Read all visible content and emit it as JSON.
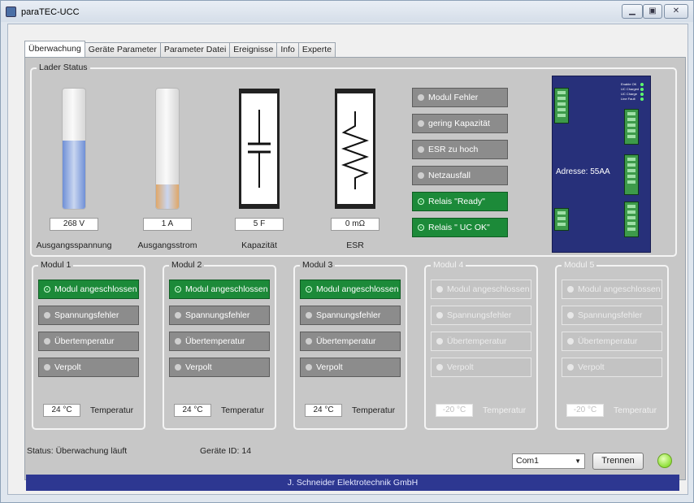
{
  "window": {
    "title": "paraTEC-UCC",
    "icon": "app-icon",
    "controls": [
      "minimize",
      "maximize",
      "close"
    ]
  },
  "tabs": [
    {
      "label": "Überwachung",
      "active": true
    },
    {
      "label": "Geräte Parameter",
      "active": false
    },
    {
      "label": "Parameter Datei",
      "active": false
    },
    {
      "label": "Ereignisse",
      "active": false
    },
    {
      "label": "Info",
      "active": false
    },
    {
      "label": "Experte",
      "active": false
    }
  ],
  "lader": {
    "title": "Lader Status",
    "gauges": [
      {
        "value": "268 V",
        "label": "Ausgangsspannung",
        "level": 0.57,
        "color": "#6f8fd6"
      },
      {
        "value": "1 A",
        "label": "Ausgangsstrom",
        "level": 0.2,
        "color": "#e0a768"
      }
    ],
    "components": [
      {
        "value": "5 F",
        "label": "Kapazität",
        "icon": "capacitor-icon"
      },
      {
        "value": "0 mΩ",
        "label": "ESR",
        "icon": "resistor-icon"
      }
    ],
    "indicators": [
      {
        "label": "Modul Fehler",
        "state": "off"
      },
      {
        "label": "gering Kapazität",
        "state": "off"
      },
      {
        "label": "ESR zu hoch",
        "state": "off"
      },
      {
        "label": "Netzausfall",
        "state": "off"
      },
      {
        "label": "Relais \"Ready\"",
        "state": "on"
      },
      {
        "label": "Relais \" UC OK\"",
        "state": "on"
      }
    ],
    "device": {
      "address": "Adresse: 55AA",
      "leds": [
        "Enable OK",
        "UC Charged",
        "UC Charge",
        "Line Fault"
      ]
    }
  },
  "modules": [
    {
      "title": "Modul 1",
      "enabled": true,
      "indicators": [
        {
          "label": "Modul angeschlossen",
          "state": "on"
        },
        {
          "label": "Spannungsfehler",
          "state": "off"
        },
        {
          "label": "Übertemperatur",
          "state": "off"
        },
        {
          "label": "Verpolt",
          "state": "off"
        }
      ],
      "temperature": "24 °C",
      "temp_label": "Temperatur"
    },
    {
      "title": "Modul 2",
      "enabled": true,
      "indicators": [
        {
          "label": "Modul angeschlossen",
          "state": "on"
        },
        {
          "label": "Spannungsfehler",
          "state": "off"
        },
        {
          "label": "Übertemperatur",
          "state": "off"
        },
        {
          "label": "Verpolt",
          "state": "off"
        }
      ],
      "temperature": "24 °C",
      "temp_label": "Temperatur"
    },
    {
      "title": "Modul 3",
      "enabled": true,
      "indicators": [
        {
          "label": "Modul angeschlossen",
          "state": "on"
        },
        {
          "label": "Spannungsfehler",
          "state": "off"
        },
        {
          "label": "Übertemperatur",
          "state": "off"
        },
        {
          "label": "Verpolt",
          "state": "off"
        }
      ],
      "temperature": "24 °C",
      "temp_label": "Temperatur"
    },
    {
      "title": "Modul 4",
      "enabled": false,
      "indicators": [
        {
          "label": "Modul angeschlossen",
          "state": "off"
        },
        {
          "label": "Spannungsfehler",
          "state": "off"
        },
        {
          "label": "Übertemperatur",
          "state": "off"
        },
        {
          "label": "Verpolt",
          "state": "off"
        }
      ],
      "temperature": "-20 °C",
      "temp_label": "Temperatur"
    },
    {
      "title": "Modul 5",
      "enabled": false,
      "indicators": [
        {
          "label": "Modul angeschlossen",
          "state": "off"
        },
        {
          "label": "Spannungsfehler",
          "state": "off"
        },
        {
          "label": "Übertemperatur",
          "state": "off"
        },
        {
          "label": "Verpolt",
          "state": "off"
        }
      ],
      "temperature": "-20 °C",
      "temp_label": "Temperatur"
    }
  ],
  "status": {
    "text": "Status: Überwachung läuft",
    "device_id": "Geräte ID: 14",
    "port": "Com1",
    "disconnect_label": "Trennen",
    "led_color": "#8fe03a"
  },
  "footer": {
    "company": "J. Schneider Elektrotechnik GmbH"
  }
}
